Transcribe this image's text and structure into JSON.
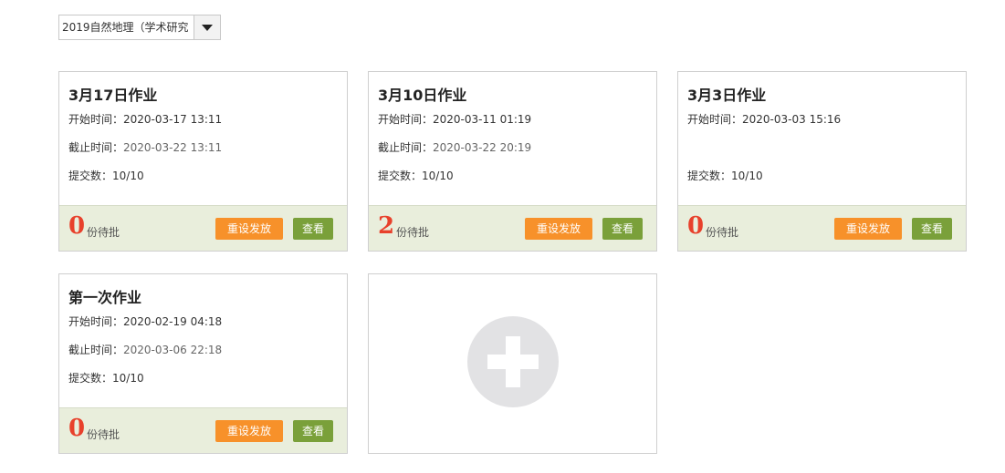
{
  "course_selector": {
    "value": "2019自然地理（学术研究"
  },
  "cards": [
    {
      "title": "3月17日作业",
      "start_label": "开始时间：",
      "start": "2020-03-17 13:11",
      "due_label": "截止时间：",
      "due": "2020-03-22 13:11",
      "submit_label": "提交数：",
      "submit": "10/10",
      "pending_count": "0",
      "pending_label": "份待批",
      "reset_label": "重设发放",
      "view_label": "查看"
    },
    {
      "title": "3月10日作业",
      "start_label": "开始时间：",
      "start": "2020-03-11 01:19",
      "due_label": "截止时间：",
      "due": "2020-03-22 20:19",
      "submit_label": "提交数：",
      "submit": "10/10",
      "pending_count": "2",
      "pending_label": "份待批",
      "reset_label": "重设发放",
      "view_label": "查看"
    },
    {
      "title": "3月3日作业",
      "start_label": "开始时间：",
      "start": "2020-03-03 15:16",
      "due_label": "",
      "due": "",
      "submit_label": "提交数：",
      "submit": "10/10",
      "pending_count": "0",
      "pending_label": "份待批",
      "reset_label": "重设发放",
      "view_label": "查看"
    },
    {
      "title": "第一次作业",
      "start_label": "开始时间：",
      "start": "2020-02-19 04:18",
      "due_label": "截止时间：",
      "due": "2020-03-06 22:18",
      "submit_label": "提交数：",
      "submit": "10/10",
      "pending_count": "0",
      "pending_label": "份待批",
      "reset_label": "重设发放",
      "view_label": "查看"
    }
  ],
  "add_card": {
    "icon": "plus-icon"
  },
  "colors": {
    "pending_count": "#e8412c",
    "reset_button": "#f7912a",
    "view_button": "#7aa03a",
    "card_footer": "#e9eedc",
    "add_circle": "#e2e2e4"
  }
}
